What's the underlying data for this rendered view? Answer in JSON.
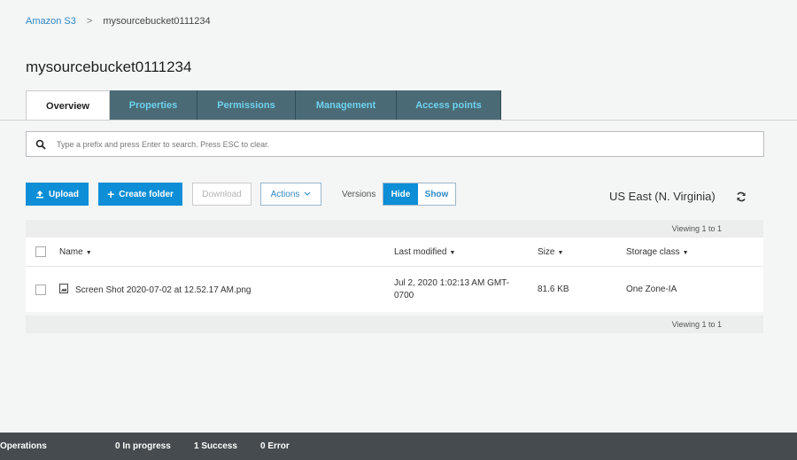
{
  "breadcrumb": {
    "root": "Amazon S3",
    "separator": ">",
    "current": "mysourcebucket0111234"
  },
  "title": "mysourcebucket0111234",
  "tabs": [
    {
      "label": "Overview"
    },
    {
      "label": "Properties"
    },
    {
      "label": "Permissions"
    },
    {
      "label": "Management"
    },
    {
      "label": "Access points"
    }
  ],
  "search": {
    "placeholder": "Type a prefix and press Enter to search. Press ESC to clear.",
    "icon": "search-icon"
  },
  "toolbar": {
    "upload": "Upload",
    "create_folder": "Create folder",
    "download": "Download",
    "actions": "Actions",
    "versions_label": "Versions",
    "hide": "Hide",
    "show": "Show",
    "region": "US East (N. Virginia)"
  },
  "table": {
    "viewing": "Viewing 1 to 1",
    "columns": {
      "name": "Name",
      "last_modified": "Last modified",
      "size": "Size",
      "storage_class": "Storage class"
    },
    "rows": [
      {
        "name": "Screen Shot 2020-07-02 at 12.52.17 AM.png",
        "last_modified_1": "Jul 2, 2020 1:02:13 AM GMT-",
        "last_modified_2": "0700",
        "size": "81.6 KB",
        "storage_class": "One Zone-IA"
      }
    ]
  },
  "footer": {
    "operations": "Operations",
    "in_progress": "0 In progress",
    "success": "1 Success",
    "error": "0 Error"
  },
  "colors": {
    "accent": "#0d8ed6",
    "tab_bg": "#4a6b76",
    "tab_text": "#6fd1ee",
    "footer_bg": "#454b4e"
  }
}
